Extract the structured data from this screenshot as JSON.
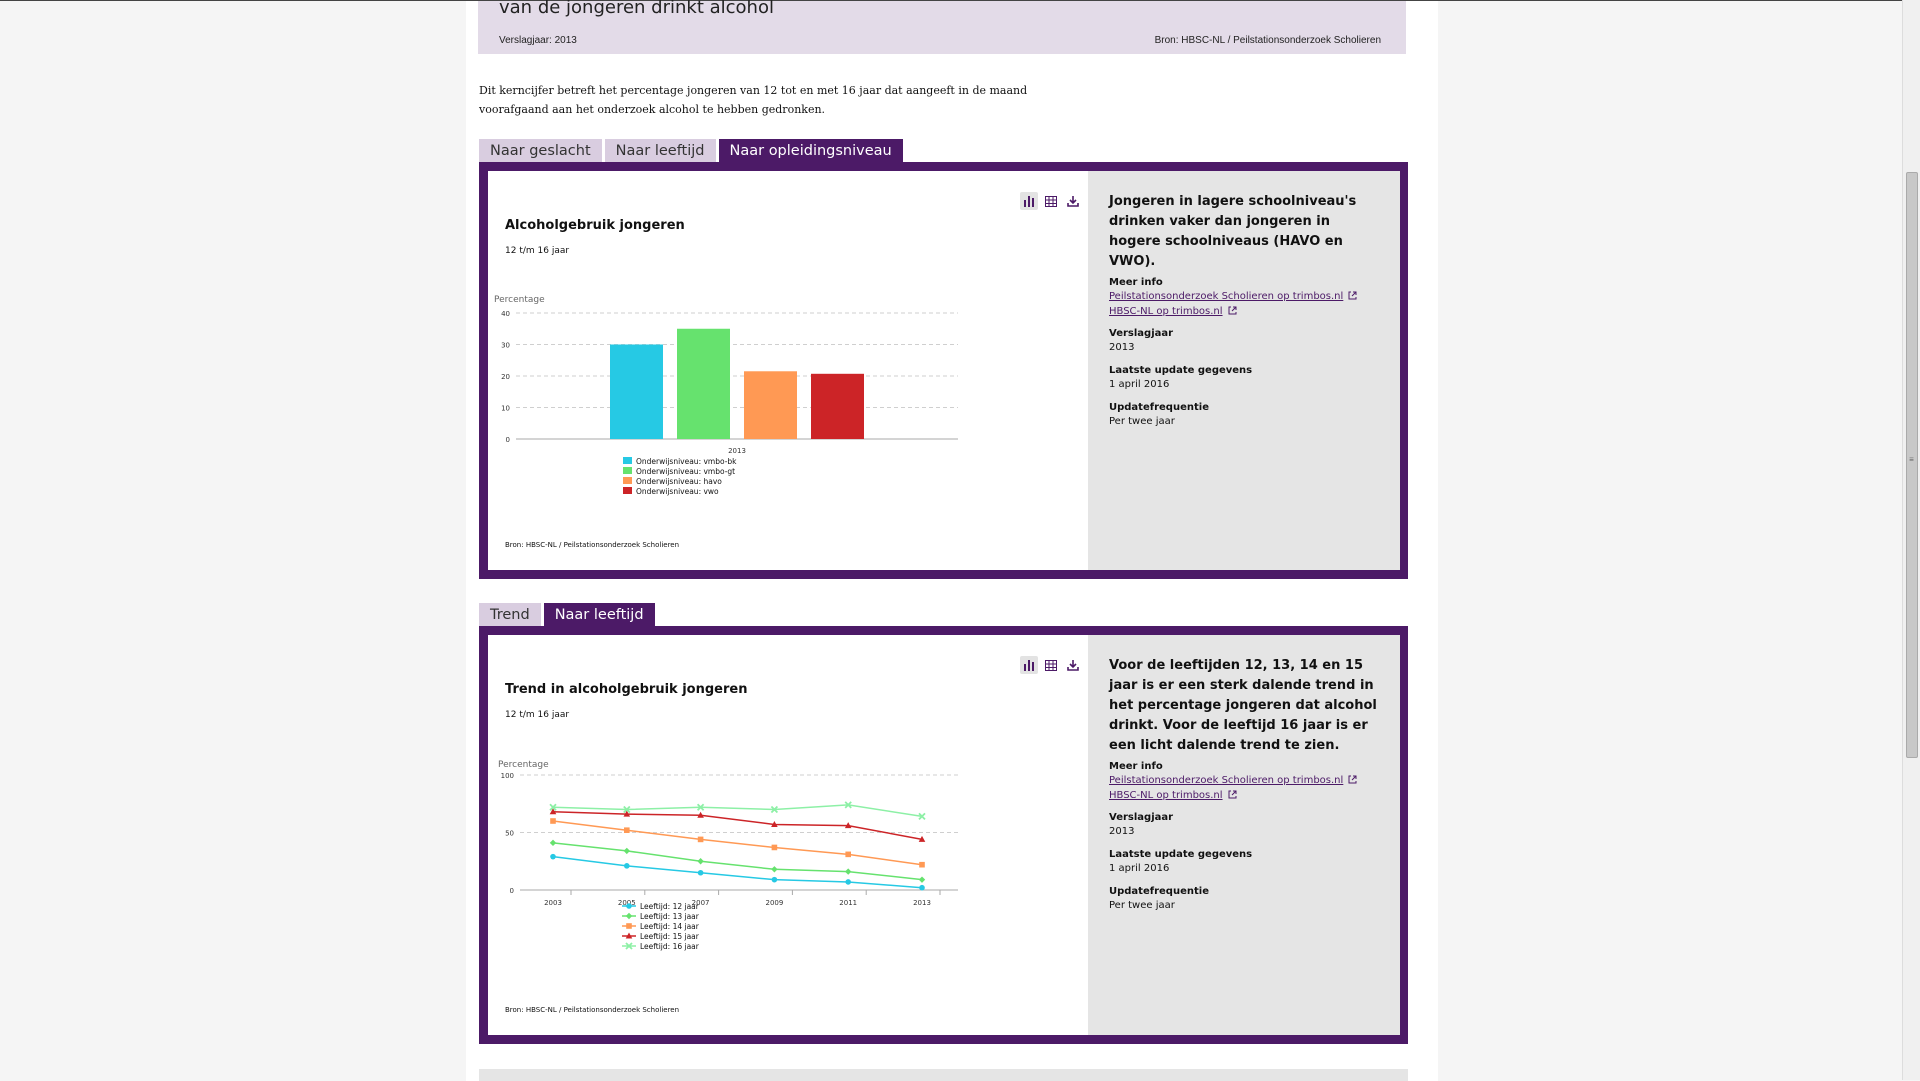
{
  "header": {
    "title": "van de jongeren drinkt alcohol",
    "year_label": "Verslagjaar: 2013",
    "source_label": "Bron: HBSC-NL / Peilstationsonderzoek Scholieren"
  },
  "intro": "Dit kerncijfer betreft het percentage jongeren van 12 tot en met 16 jaar dat aangeeft in de maand voorafgaand aan het onderzoek alcohol te hebben gedronken.",
  "section1": {
    "tabs": [
      "Naar geslacht",
      "Naar leeftijd",
      "Naar opleidingsniveau"
    ],
    "active_tab": 2,
    "icons": [
      "bar-chart-icon",
      "table-icon",
      "download-icon"
    ],
    "chart_title": "Alcoholgebruik jongeren",
    "chart_subtitle": "12 t/m 16 jaar",
    "chart_source": "Bron: HBSC-NL / Peilstationsonderzoek Scholieren",
    "info": {
      "headline": "Jongeren in lagere schoolniveau's drinken vaker dan jongeren in hogere schoolniveaus (HAVO en VWO).",
      "more_info_label": "Meer info",
      "links": [
        "Peilstationsonderzoek Scholieren op trimbos.nl",
        "HBSC-NL op trimbos.nl"
      ],
      "year_label": "Verslagjaar",
      "year_value": "2013",
      "update_label": "Laatste update gegevens",
      "update_value": "1 april 2016",
      "freq_label": "Updatefrequentie",
      "freq_value": "Per twee jaar"
    }
  },
  "section2": {
    "tabs": [
      "Trend",
      "Naar leeftijd"
    ],
    "active_tab": 1,
    "icons": [
      "bar-chart-icon",
      "table-icon",
      "download-icon"
    ],
    "chart_title": "Trend in alcoholgebruik jongeren",
    "chart_subtitle": "12 t/m 16 jaar",
    "chart_source": "Bron: HBSC-NL / Peilstationsonderzoek Scholieren",
    "info": {
      "headline": "Voor de leeftijden 12, 13, 14 en 15 jaar is er een sterk dalende trend in het percentage jongeren dat alcohol drinkt. Voor de leeftijd 16 jaar is er een licht dalende trend te zien.",
      "more_info_label": "Meer info",
      "links": [
        "Peilstationsonderzoek Scholieren op trimbos.nl",
        "HBSC-NL op trimbos.nl"
      ],
      "year_label": "Verslagjaar",
      "year_value": "2013",
      "update_label": "Laatste update gegevens",
      "update_value": "1 april 2016",
      "freq_label": "Updatefrequentie",
      "freq_value": "Per twee jaar"
    }
  },
  "chart_data": [
    {
      "type": "bar",
      "title": "Alcoholgebruik jongeren",
      "subtitle": "12 t/m 16 jaar",
      "ylabel": "Percentage",
      "xlabel": "",
      "ylim": [
        0,
        40
      ],
      "yticks": [
        0,
        10,
        20,
        30,
        40
      ],
      "categories": [
        "2013"
      ],
      "grid": true,
      "legend_position": "bottom",
      "series": [
        {
          "name": "Onderwijsniveau: vmbo-bk",
          "color": "#26c9e4",
          "values": [
            30
          ]
        },
        {
          "name": "Onderwijsniveau: vmbo-gt",
          "color": "#66e26e",
          "values": [
            35
          ]
        },
        {
          "name": "Onderwijsniveau: havo",
          "color": "#ff9954",
          "values": [
            21.5
          ]
        },
        {
          "name": "Onderwijsniveau: vwo",
          "color": "#cc2427",
          "values": [
            20.7
          ]
        }
      ]
    },
    {
      "type": "line",
      "title": "Trend in alcoholgebruik jongeren",
      "subtitle": "12 t/m 16 jaar",
      "ylabel": "Percentage",
      "xlabel": "",
      "ylim": [
        0,
        100
      ],
      "yticks": [
        0,
        50,
        100
      ],
      "x": [
        "2003",
        "2005",
        "2007",
        "2009",
        "2011",
        "2013"
      ],
      "grid": true,
      "legend_position": "bottom",
      "series": [
        {
          "name": "Leeftijd: 12 jaar",
          "color": "#26c9e4",
          "marker": "circle",
          "values": [
            29,
            21,
            15,
            9,
            7,
            2
          ]
        },
        {
          "name": "Leeftijd: 13 jaar",
          "color": "#66e26e",
          "marker": "diamond",
          "values": [
            41,
            34,
            25,
            18,
            16,
            9
          ]
        },
        {
          "name": "Leeftijd: 14 jaar",
          "color": "#ff9954",
          "marker": "square",
          "values": [
            60,
            52,
            44,
            37,
            31,
            22
          ]
        },
        {
          "name": "Leeftijd: 15 jaar",
          "color": "#cc2427",
          "marker": "triangle",
          "values": [
            68,
            66,
            65,
            57,
            56,
            44
          ]
        },
        {
          "name": "Leeftijd: 16 jaar",
          "color": "#8df0a6",
          "marker": "cross",
          "values": [
            72,
            70,
            72,
            70,
            74,
            64
          ]
        }
      ]
    }
  ]
}
